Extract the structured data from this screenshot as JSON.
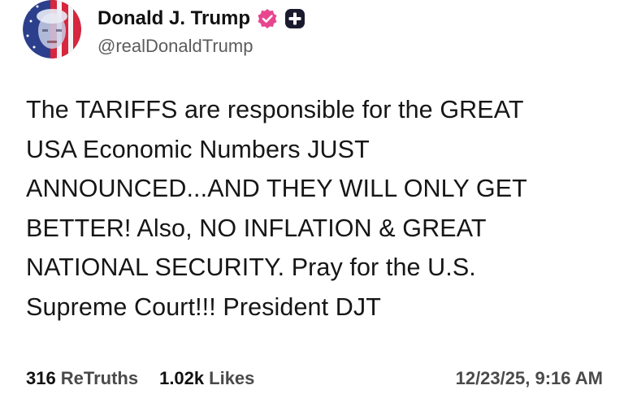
{
  "post": {
    "author": {
      "display_name": "Donald J. Trump",
      "handle": "@realDonaldTrump",
      "verified": true,
      "badge_color": "#e8458f"
    },
    "body_lines": [
      "The TARIFFS are responsible for the GREAT",
      "USA Economic Numbers JUST",
      "ANNOUNCED...AND THEY WILL ONLY GET",
      "BETTER! Also, NO INFLATION & GREAT",
      "NATIONAL SECURITY. Pray for the U.S.",
      "Supreme Court!!! President DJT"
    ],
    "stats": {
      "retruths_count": "316",
      "retruths_label": "ReTruths",
      "likes_count": "1.02k",
      "likes_label": "Likes"
    },
    "timestamp": "12/23/25, 9:16 AM"
  },
  "icons": {
    "avatar": "flag-portrait-avatar",
    "verified": "verified-badge-icon",
    "plus": "plus-badge-icon"
  }
}
